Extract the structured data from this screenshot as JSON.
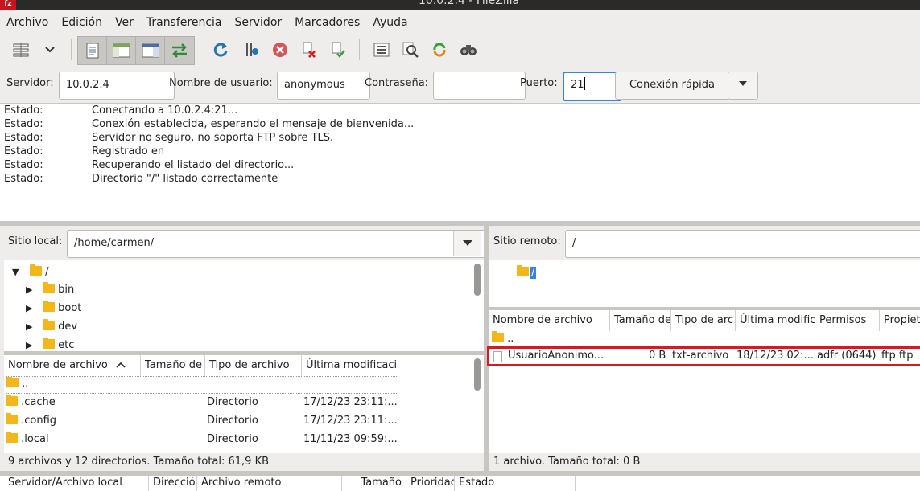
{
  "window": {
    "title": "10.0.2.4 - FileZilla",
    "logo": "fz"
  },
  "menu": [
    "Archivo",
    "Edición",
    "Ver",
    "Transferencia",
    "Servidor",
    "Marcadores",
    "Ayuda"
  ],
  "toolbar_icons": [
    "site-manager-icon",
    "dropdown-arrow-icon",
    "message-log-toggle-icon",
    "local-tree-toggle-icon",
    "remote-tree-toggle-icon",
    "transfer-queue-toggle-icon",
    "refresh-icon",
    "process-queue-icon",
    "cancel-icon",
    "disconnect-icon",
    "reconnect-icon",
    "directory-listing-filter-icon",
    "compare-directories-icon",
    "sync-browsing-icon",
    "search-files-icon"
  ],
  "quickconnect": {
    "server_label": "Servidor:",
    "server_value": "10.0.2.4",
    "user_label": "Nombre de usuario:",
    "user_value": "anonymous",
    "password_label": "Contraseña:",
    "password_value": "",
    "port_label": "Puerto:",
    "port_value": "21",
    "connect_label": "Conexión rápida"
  },
  "log": [
    {
      "k": "Estado:",
      "v": "Conectando a 10.0.2.4:21..."
    },
    {
      "k": "Estado:",
      "v": "Conexión establecida, esperando el mensaje de bienvenida..."
    },
    {
      "k": "Estado:",
      "v": "Servidor no seguro, no soporta FTP sobre TLS."
    },
    {
      "k": "Estado:",
      "v": "Registrado en"
    },
    {
      "k": "Estado:",
      "v": "Recuperando el listado del directorio..."
    },
    {
      "k": "Estado:",
      "v": "Directorio \"/\" listado correctamente"
    }
  ],
  "local": {
    "site_label": "Sitio local:",
    "path": "/home/carmen/",
    "tree": [
      "/",
      "bin",
      "boot",
      "dev",
      "etc"
    ],
    "columns": [
      "Nombre de archivo",
      "Tamaño de",
      "Tipo de archivo",
      "Última modificaci"
    ],
    "files": [
      {
        "name": "..",
        "type": "",
        "modified": ""
      },
      {
        "name": ".cache",
        "type": "Directorio",
        "modified": "17/12/23 23:11:..."
      },
      {
        "name": ".config",
        "type": "Directorio",
        "modified": "17/12/23 23:11:..."
      },
      {
        "name": ".local",
        "type": "Directorio",
        "modified": "11/11/23 09:59:..."
      }
    ],
    "status": "9 archivos y 12 directorios. Tamaño total: 61,9 KB"
  },
  "remote": {
    "site_label": "Sitio remoto:",
    "path": "/",
    "tree": [
      "/"
    ],
    "columns": [
      "Nombre de archivo",
      "Tamaño de",
      "Tipo de arc",
      "Última modific",
      "Permisos",
      "Propiet"
    ],
    "files": [
      {
        "name": "..",
        "size": "",
        "type": "",
        "modified": "",
        "perms": "",
        "owner": ""
      },
      {
        "name": "UsuarioAnonimo...",
        "size": "0 B",
        "type": "txt-archivo",
        "modified": "18/12/23 02:...",
        "perms": "adfr (0644)",
        "owner": "ftp ftp"
      }
    ],
    "status": "1 archivo. Tamaño total: 0 B"
  },
  "queue": {
    "columns": [
      "Servidor/Archivo local",
      "Direcció",
      "Archivo remoto",
      "Tamaño",
      "Prioridad",
      "Estado"
    ]
  },
  "colors": {
    "highlight_box": "#d9181f",
    "selection": "#3584e4",
    "folder": "#f5b61a"
  }
}
